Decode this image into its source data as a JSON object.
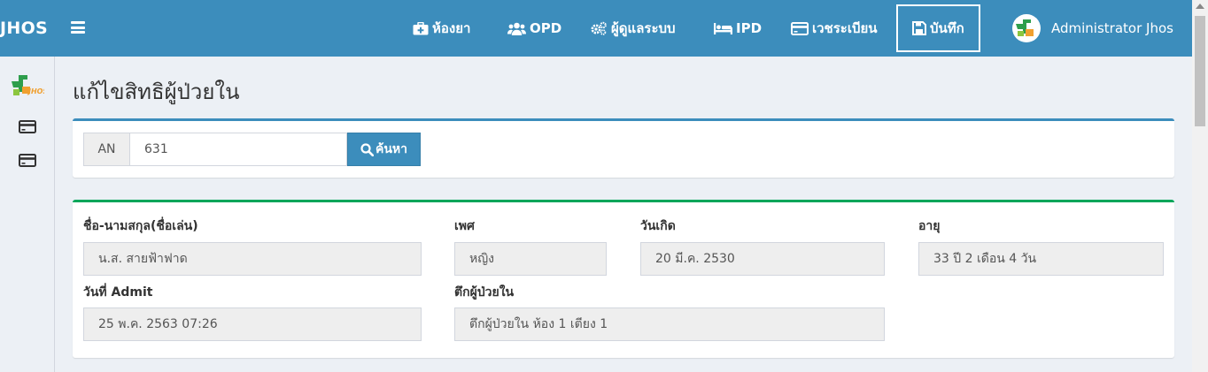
{
  "app": {
    "brand": "JHOS"
  },
  "nav": {
    "pharmacy": "ห้องยา",
    "opd": "OPD",
    "admin": "ผู้ดูแลระบบ",
    "ipd": "IPD",
    "records": "เวชระเบียน",
    "save": "บันทึก",
    "user": "Administrator Jhos"
  },
  "page": {
    "title": "แก้ไขสิทธิผู้ป่วยใน"
  },
  "search": {
    "addon": "AN",
    "value": "631",
    "button": "ค้นหา"
  },
  "patient": {
    "name_label": "ชื่อ-นามสกุล(ชื่อเล่น)",
    "name": "น.ส. สายฟ้าฟาด",
    "gender_label": "เพศ",
    "gender": "หญิง",
    "dob_label": "วันเกิด",
    "dob": "20 มี.ค. 2530",
    "age_label": "อายุ",
    "age": "33 ปี 2 เดือน 4 วัน",
    "admit_label": "วันที่ Admit",
    "admit": "25 พ.ค. 2563 07:26",
    "ward_label": "ตึกผู้ป่วยใน",
    "ward": "ตึกผู้ป่วยใน ห้อง 1 เตียง 1"
  },
  "colors": {
    "navbar": "#3c8dbc",
    "search_box_top": "#3c8dbc",
    "info_box_top": "#00a65a"
  },
  "icons": [
    "medkit-icon",
    "users-icon",
    "cogs-icon",
    "bed-icon",
    "credit-card-icon",
    "save-icon",
    "search-icon",
    "jhos-logo-icon"
  ]
}
